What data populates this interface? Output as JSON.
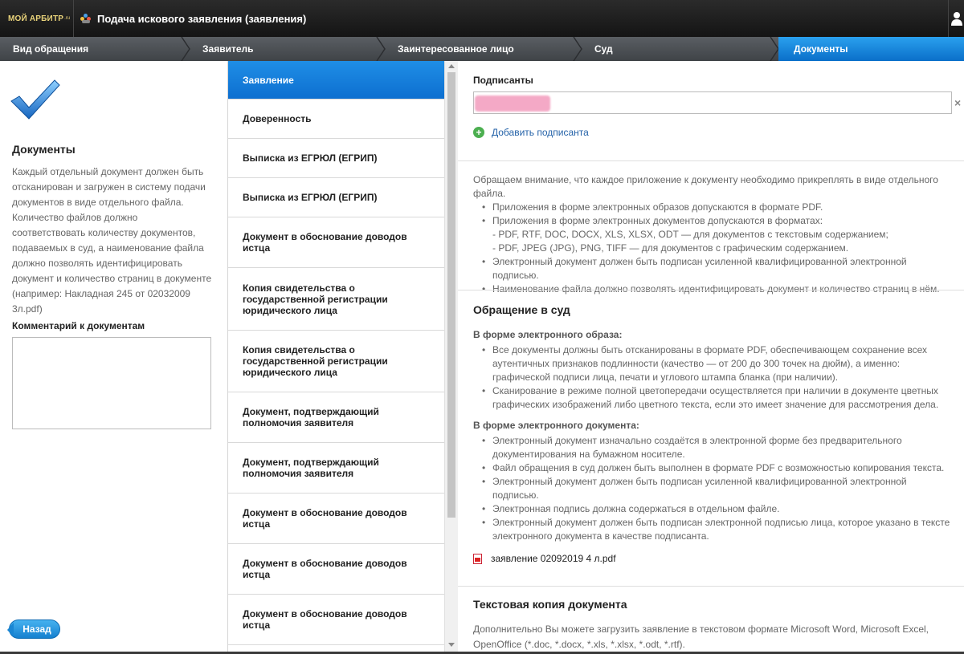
{
  "app": {
    "logo_main": "МОЙ АРБИТР",
    "logo_suffix": ".ru",
    "title": "Подача искового заявления (заявления)"
  },
  "steps": [
    {
      "label": "Вид обращения",
      "active": false
    },
    {
      "label": "Заявитель",
      "active": false
    },
    {
      "label": "Заинтересованное лицо",
      "active": false
    },
    {
      "label": "Суд",
      "active": false
    },
    {
      "label": "Документы",
      "active": true
    }
  ],
  "left": {
    "title": "Документы",
    "description": "Каждый отдельный документ должен быть отсканирован и загружен в систему подачи документов в виде отдельного файла. Количество файлов должно соответствовать количеству документов, подаваемых в суд, а наименование файла должно позволять идентифицировать документ и количество страниц в документе (например: Накладная 245 от 02032009 3л.pdf)",
    "comment_label": "Комментарий к документам",
    "comment_value": "",
    "back_label": "Назад"
  },
  "documents": [
    {
      "label": "Заявление",
      "active": true
    },
    {
      "label": "Доверенность",
      "active": false
    },
    {
      "label": "Выписка из ЕГРЮЛ (ЕГРИП)",
      "active": false
    },
    {
      "label": "Выписка из ЕГРЮЛ (ЕГРИП)",
      "active": false
    },
    {
      "label": "Документ в обоснование доводов истца",
      "active": false
    },
    {
      "label": "Копия свидетельства о государственной регистрации юридического лица",
      "active": false
    },
    {
      "label": "Копия свидетельства о государственной регистрации юридического лица",
      "active": false
    },
    {
      "label": "Документ, подтверждающий полномочия заявителя",
      "active": false
    },
    {
      "label": "Документ, подтверждающий полномочия заявителя",
      "active": false
    },
    {
      "label": "Документ в обоснование доводов истца",
      "active": false
    },
    {
      "label": "Документ в обоснование доводов истца",
      "active": false
    },
    {
      "label": "Документ в обоснование доводов истца",
      "active": false
    }
  ],
  "right": {
    "signers_label": "Подписанты",
    "clear_symbol": "×",
    "add_signer": "Добавить подписанта",
    "notice": {
      "intro": "Обращаем внимание, что каждое приложение к документу необходимо прикреплять в виде отдельного файла.",
      "lines": [
        {
          "text": "Приложения в форме электронных образов допускаются в формате PDF.",
          "bullet": true
        },
        {
          "text": "Приложения в форме электронных документов допускаются в форматах:",
          "bullet": true
        },
        {
          "text": "- PDF, RTF, DOC, DOCX, XLS, XLSX, ODT — для документов с текстовым содержанием;",
          "bullet": false
        },
        {
          "text": "- PDF, JPEG (JPG), PNG, TIFF — для документов с графическим содержанием.",
          "bullet": false
        },
        {
          "text": "Электронный документ должен быть подписан усиленной квалифицированной электронной подписью.",
          "bullet": true
        },
        {
          "text": "Наименование файла должно позволять идентифицировать документ и количество страниц в нём.",
          "bullet": true
        }
      ]
    },
    "court_title": "Обращение в суд",
    "image_form_title": "В форме электронного образа:",
    "image_form_bullets": [
      "Все документы должны быть отсканированы в формате PDF, обеспечивающем сохранение всех аутентичных признаков подлинности (качество — от 200 до 300 точек на дюйм), а именно: графической подписи лица, печати и углового штампа бланка (при наличии).",
      "Сканирование в режиме полной цветопередачи осуществляется при наличии в документе цветных графических изображений либо цветного текста, если это имеет значение для рассмотрения дела."
    ],
    "doc_form_title": "В форме электронного документа:",
    "doc_form_bullets": [
      "Электронный документ изначально создаётся в электронной форме без предварительного документирования на бумажном носителе.",
      "Файл обращения в суд должен быть выполнен в формате PDF с возможностью копирования текста.",
      "Электронный документ должен быть подписан усиленной квалифицированной электронной подписью.",
      "Электронная подпись должна содержаться в отдельном файле.",
      "Электронный документ должен быть подписан электронной подписью лица, которое указано в тексте электронного документа в качестве подписанта."
    ],
    "attached_file": "заявление 02092019 4 л.pdf",
    "text_copy_title": "Текстовая копия документа",
    "text_copy_desc": "Дополнительно Вы можете загрузить заявление в текстовом формате Microsoft Word, Microsoft Excel, OpenOffice (*.doc, *.docx, *.xls, *.xlsx, *.odt, *.rtf)."
  }
}
